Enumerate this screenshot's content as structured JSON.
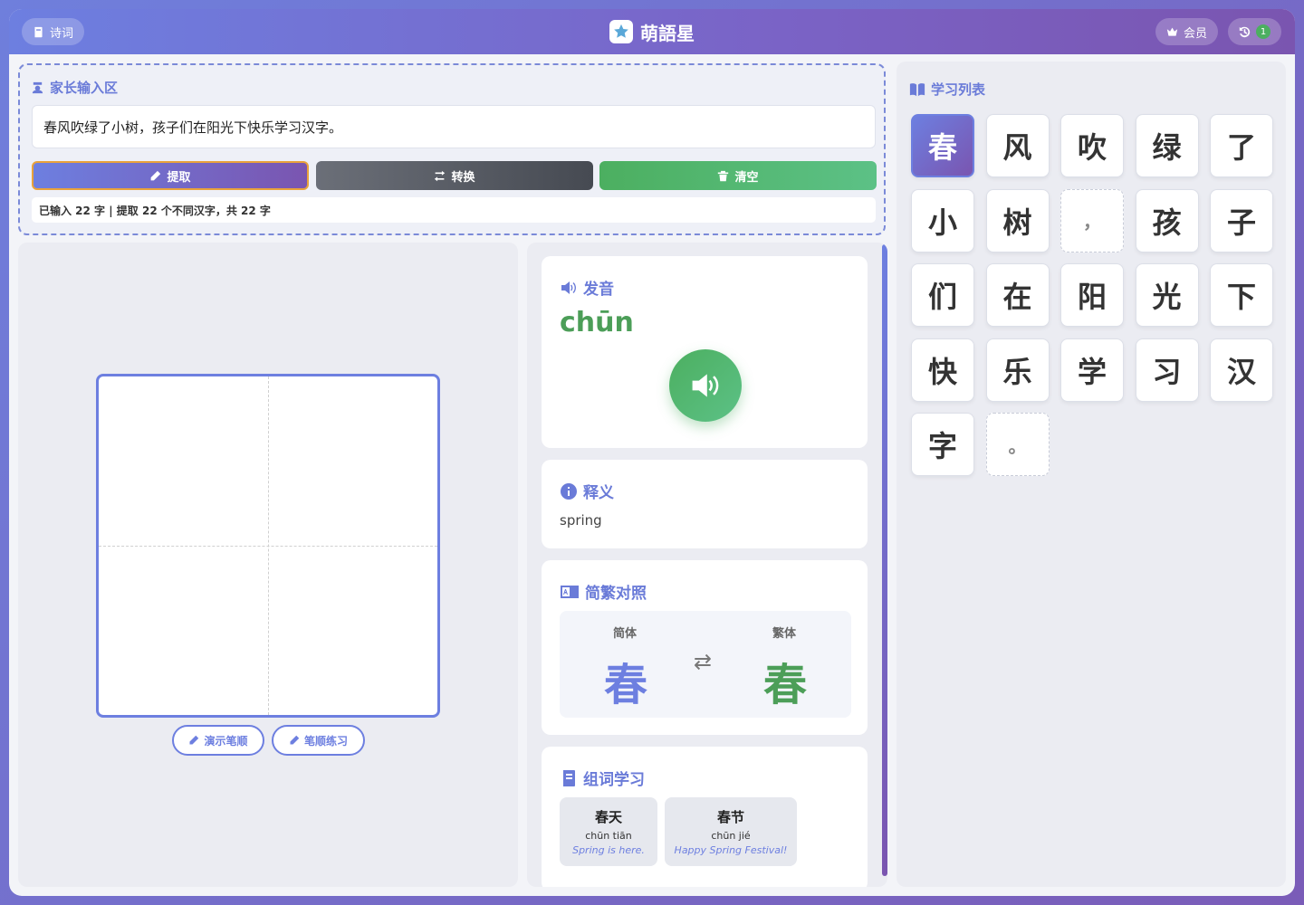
{
  "header": {
    "poems_label": "诗词",
    "app_title": "萌語星",
    "member_label": "会员",
    "history_count": "1"
  },
  "parent_input": {
    "title": "家长输入区",
    "text_value": "春风吹绿了小树，孩子们在阳光下快乐学习汉字。",
    "extract_label": "提取",
    "convert_label": "转换",
    "clear_label": "清空",
    "stats_text": "已输入 22 字 | 提取 22 个不同汉字，共 22 字"
  },
  "writing": {
    "demo_stroke_label": "演示笔顺",
    "practice_stroke_label": "笔顺练习"
  },
  "pronunciation": {
    "title": "发音",
    "pinyin": "chūn"
  },
  "meaning": {
    "title": "释义",
    "text": "spring"
  },
  "comparison": {
    "title": "简繁对照",
    "simplified_label": "简体",
    "traditional_label": "繁体",
    "simplified_char": "春",
    "traditional_char": "春",
    "arrow": "⇄"
  },
  "words": {
    "title": "组词学习",
    "items": [
      {
        "hanzi": "春天",
        "pinyin": "chūn tiān",
        "english": "Spring is here."
      },
      {
        "hanzi": "春节",
        "pinyin": "chūn jié",
        "english": "Happy Spring Festival!"
      }
    ]
  },
  "learning_list": {
    "title": "学习列表",
    "chars": [
      "春",
      "风",
      "吹",
      "绿",
      "了",
      "小",
      "树",
      "，",
      "孩",
      "子",
      "们",
      "在",
      "阳",
      "光",
      "下",
      "快",
      "乐",
      "学",
      "习",
      "汉",
      "字",
      "。"
    ],
    "selected_index": 0
  },
  "colors": {
    "primary": "#6d7fe0",
    "secondary": "#7a55b0",
    "success": "#4caf60"
  },
  "icons": {
    "poems": "book-icon",
    "member": "crown-icon",
    "history": "history-icon",
    "parent": "user-icon",
    "extract": "pencil-icon",
    "convert": "swap-icon",
    "clear": "trash-icon",
    "sound": "volume-icon",
    "info": "info-icon",
    "language": "language-icon",
    "words": "notebook-icon",
    "list": "open-book-icon"
  }
}
